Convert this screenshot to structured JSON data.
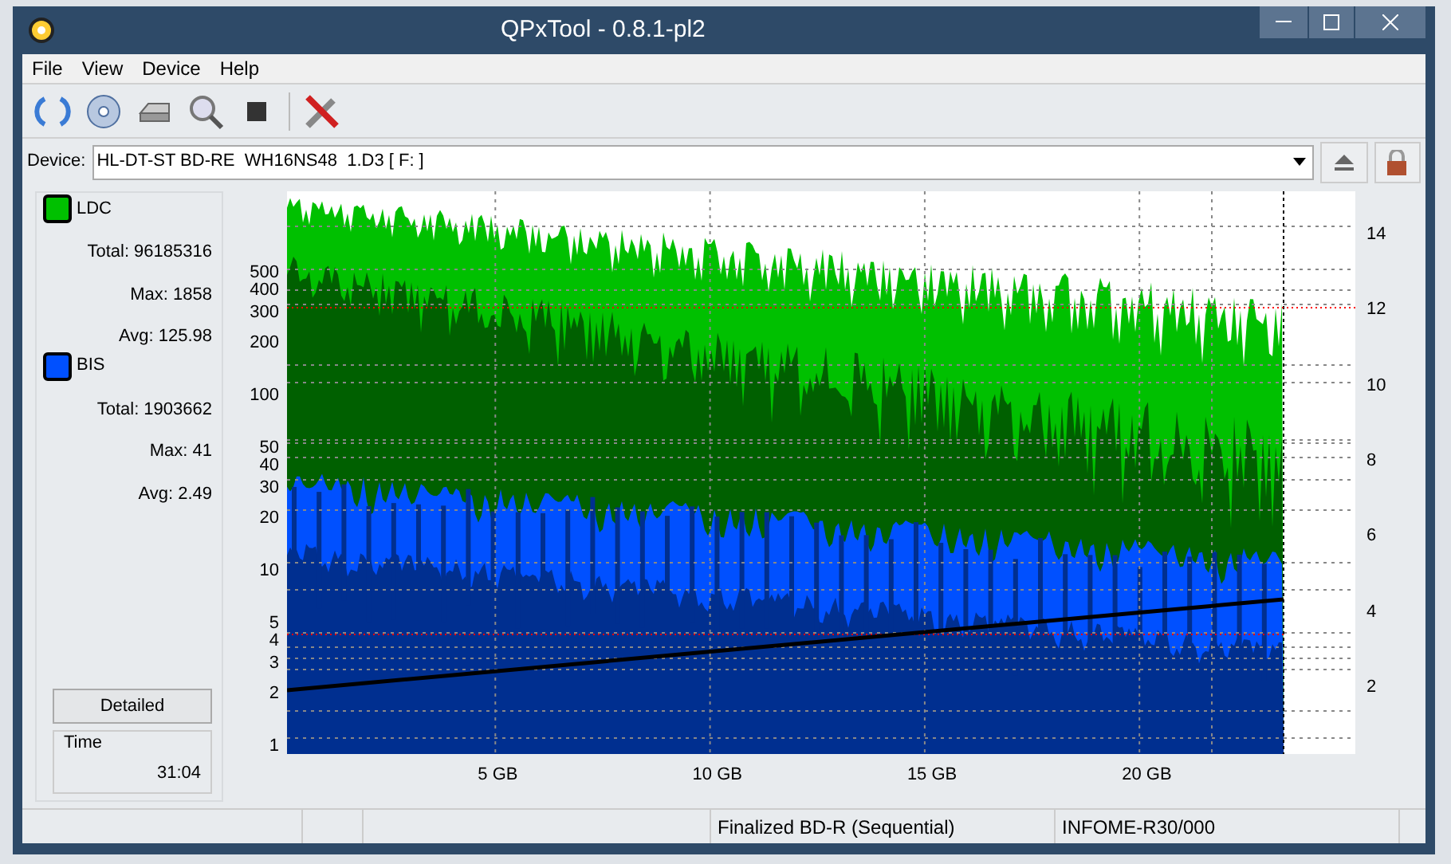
{
  "window": {
    "title": "QPxTool - 0.8.1-pl2"
  },
  "menu": [
    "File",
    "View",
    "Device",
    "Help"
  ],
  "device": {
    "label": "Device:",
    "value": "HL-DT-ST BD-RE  WH16NS48  1.D3 [ F: ]"
  },
  "legend": [
    {
      "name": "LDC",
      "color": "#00c000",
      "stats": [
        "Total: 96185316",
        "Max: 1858",
        "Avg: 125.98"
      ]
    },
    {
      "name": "BIS",
      "color": "#0050ff",
      "stats": [
        "Total: 1903662",
        "Max: 41",
        "Avg: 2.49"
      ]
    }
  ],
  "detailed_button": "Detailed",
  "time": {
    "label": "Time",
    "value": "31:04"
  },
  "chart": {
    "left_ticks": [
      "500",
      "400",
      "300",
      "200",
      "100",
      "50",
      "40",
      "30",
      "20",
      "10",
      "5",
      "4",
      "3",
      "2",
      "1"
    ],
    "right_ticks": [
      "14",
      "12",
      "10",
      "8",
      "6",
      "4",
      "2"
    ],
    "x_ticks": [
      "5 GB",
      "10 GB",
      "15 GB",
      "20 GB"
    ]
  },
  "status_bar": [
    "Finalized BD-R (Sequential)",
    "INFOME-R30/000"
  ]
}
